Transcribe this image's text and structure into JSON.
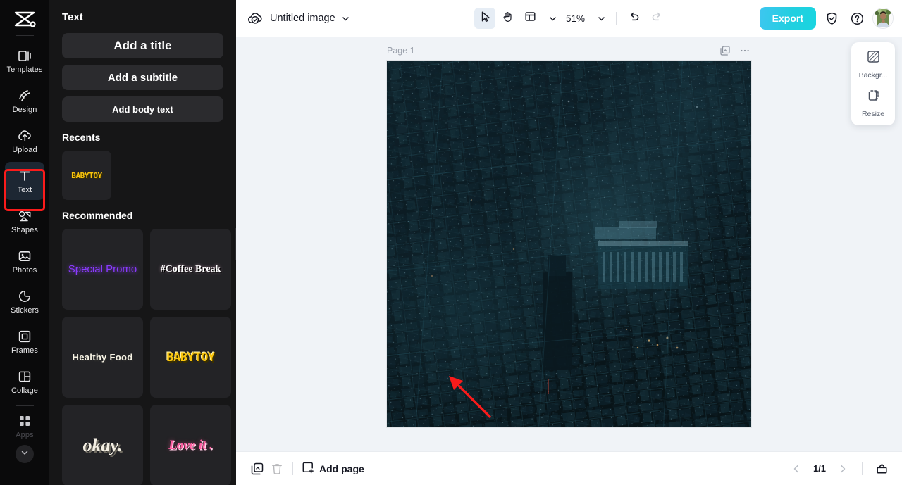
{
  "app": {
    "logo_icon": "capcut-logo-icon"
  },
  "rail": {
    "items": [
      {
        "label": "Templates",
        "icon": "templates-icon",
        "active": false
      },
      {
        "label": "Design",
        "icon": "design-icon",
        "active": false
      },
      {
        "label": "Upload",
        "icon": "upload-cloud-icon",
        "active": false
      },
      {
        "label": "Text",
        "icon": "text-t-icon",
        "active": true
      },
      {
        "label": "Shapes",
        "icon": "shapes-icon",
        "active": false
      },
      {
        "label": "Photos",
        "icon": "photos-icon",
        "active": false
      },
      {
        "label": "Stickers",
        "icon": "stickers-icon",
        "active": false
      },
      {
        "label": "Frames",
        "icon": "frames-icon",
        "active": false
      },
      {
        "label": "Collage",
        "icon": "collage-icon",
        "active": false
      }
    ],
    "apps": {
      "label": "Apps",
      "icon": "apps-grid-icon"
    },
    "expand_icon": "chevron-down-icon"
  },
  "panel": {
    "title": "Text",
    "buttons": [
      {
        "label": "Add a title"
      },
      {
        "label": "Add a subtitle"
      },
      {
        "label": "Add body text"
      }
    ],
    "recents_heading": "Recents",
    "recents": [
      {
        "label": "BABYTOY",
        "style": "sp-baby-sm"
      }
    ],
    "recommended_heading": "Recommended",
    "recommended": [
      {
        "label": "Special Promo",
        "style": "sp-promo"
      },
      {
        "label": "#Coffee Break",
        "style": "sp-coffee"
      },
      {
        "label": "Healthy Food",
        "style": "sp-healthy"
      },
      {
        "label": "BABYTOY",
        "style": "sp-baby"
      },
      {
        "label": "okay.",
        "style": "sp-okay"
      },
      {
        "label": "Love it .",
        "style": "sp-love"
      }
    ],
    "collapse_icon": "chevron-left-icon"
  },
  "topbar": {
    "cloud_icon": "cloud-saved-icon",
    "doc_title": "Untitled image",
    "title_chevron_icon": "chevron-down-icon",
    "tools": [
      {
        "name": "select-tool",
        "icon": "cursor-arrow-icon",
        "active": true
      },
      {
        "name": "hand-tool",
        "icon": "hand-icon",
        "active": false
      }
    ],
    "layout_icon": "layout-icon",
    "layout_chevron_icon": "chevron-down-icon",
    "zoom_value": "51%",
    "zoom_chevron_icon": "chevron-down-icon",
    "undo_icon": "undo-icon",
    "redo_icon": "redo-icon",
    "export_label": "Export",
    "shield_icon": "shield-icon",
    "help_icon": "help-circle-icon",
    "avatar_icon": "user-avatar"
  },
  "canvas": {
    "page_label": "Page 1",
    "duplicate_page_icon": "duplicate-page-icon",
    "more_icon": "more-horizontal-icon",
    "image_alt": "aerial night cityscape"
  },
  "float_panel": {
    "items": [
      {
        "label": "Backgr...",
        "icon": "background-icon"
      },
      {
        "label": "Resize",
        "icon": "resize-icon"
      }
    ]
  },
  "bottombar": {
    "duplicate_icon": "duplicate-icon",
    "delete_icon": "trash-icon",
    "add_page_label": "Add page",
    "add_page_icon": "add-page-icon",
    "prev_icon": "chevron-left-icon",
    "page_count": "1/1",
    "next_icon": "chevron-right-icon",
    "present_icon": "present-icon"
  },
  "colors": {
    "accent_export": "#22cfe0",
    "annotation_red": "#fb1b1b",
    "rail_bg": "#0a0a0b",
    "panel_bg": "#161617",
    "canvas_bg": "#f0f3f7"
  }
}
